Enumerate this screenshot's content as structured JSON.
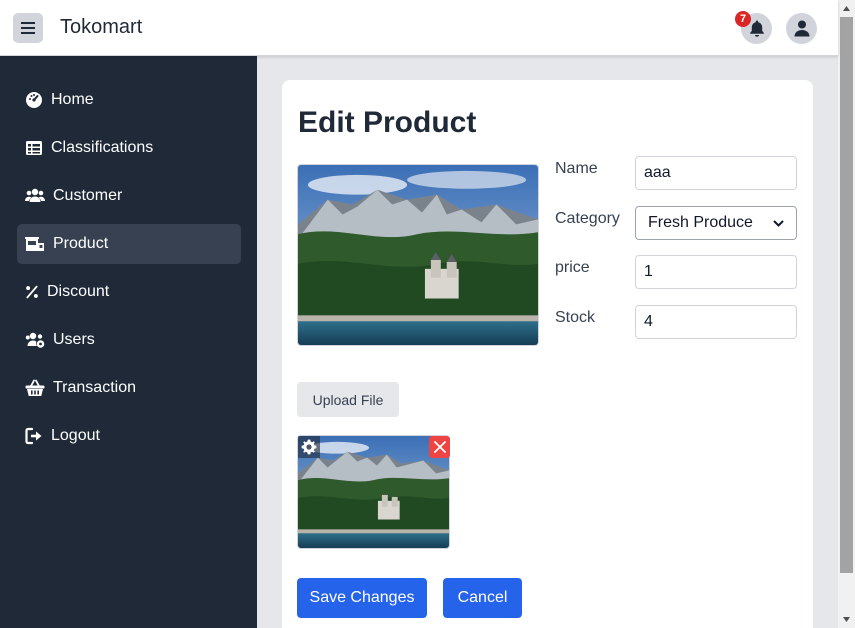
{
  "app": {
    "brand": "Tokomart",
    "notification_count": "7"
  },
  "sidebar": {
    "items": [
      {
        "label": "Home",
        "icon": "dashboard-icon",
        "active": false
      },
      {
        "label": "Classifications",
        "icon": "table-icon",
        "active": false
      },
      {
        "label": "Customer",
        "icon": "users-icon",
        "active": false
      },
      {
        "label": "Product",
        "icon": "store-icon",
        "active": true
      },
      {
        "label": "Discount",
        "icon": "percent-icon",
        "active": false
      },
      {
        "label": "Users",
        "icon": "users-gear-icon",
        "active": false
      },
      {
        "label": "Transaction",
        "icon": "basket-icon",
        "active": false
      },
      {
        "label": "Logout",
        "icon": "logout-icon",
        "active": false
      }
    ]
  },
  "page": {
    "title": "Edit Product"
  },
  "form": {
    "name_label": "Name",
    "name_value": "aaa",
    "category_label": "Category",
    "category_value": "Fresh Produce",
    "price_label": "price",
    "price_value": "1",
    "stock_label": "Stock",
    "stock_value": "4"
  },
  "actions": {
    "upload_label": "Upload File",
    "save_label": "Save Changes",
    "cancel_label": "Cancel"
  },
  "colors": {
    "sidebar_bg": "#1f2937",
    "sidebar_active": "#374151",
    "primary": "#2563eb",
    "danger": "#ef4444",
    "badge": "#dc2626"
  }
}
